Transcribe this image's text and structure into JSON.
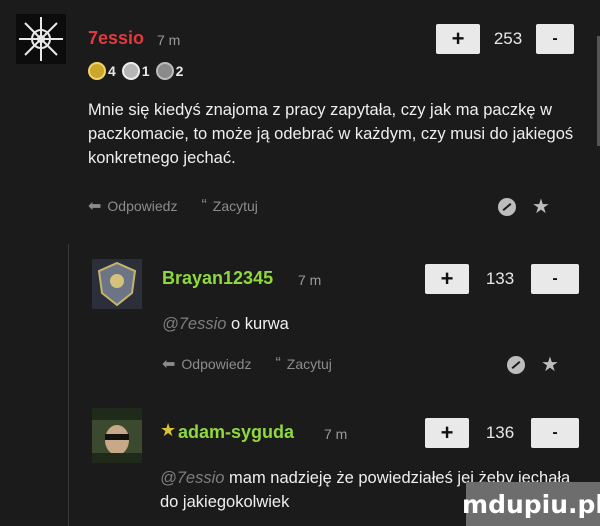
{
  "comments": [
    {
      "username": "7essio",
      "time": "7 m",
      "score": "253",
      "badges": [
        {
          "medal": "gold",
          "count": "4"
        },
        {
          "medal": "silver",
          "count": "1"
        },
        {
          "medal": "bronze",
          "count": "2"
        }
      ],
      "text": "Mnie się kiedyś znajoma z pracy zapytała, czy jak ma paczkę w paczkomacie, to może ją odebrać w każdym, czy musi do jakiegoś konkretnego jechać."
    },
    {
      "username": "Brayan12345",
      "time": "7 m",
      "score": "133",
      "mention": "@7essio",
      "text": "o kurwa"
    },
    {
      "username": "adam-syguda",
      "time": "7 m",
      "score": "136",
      "mention": "@7essio",
      "text": "mam nadzieję że powiedziałeś jej żeby jechała do jakiegokolwiek"
    }
  ],
  "actions": {
    "reply": "Odpowiedz",
    "quote": "Zacytuj"
  },
  "vote": {
    "plus": "+",
    "minus": "-"
  },
  "watermark": "mdupiu.pl",
  "colors": {
    "op_username": "#e0393e",
    "username": "#8fd83e",
    "background": "#1b1b1b"
  }
}
